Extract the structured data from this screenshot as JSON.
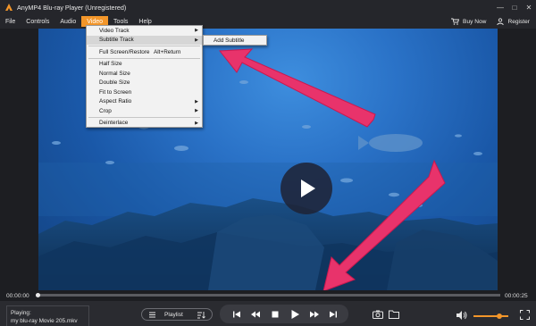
{
  "window": {
    "title": "AnyMP4 Blu-ray Player (Unregistered)",
    "controls": [
      "—",
      "□",
      "✕"
    ]
  },
  "menubar": {
    "items": [
      "File",
      "Controls",
      "Audio",
      "Video",
      "Tools",
      "Help"
    ],
    "active": "Video",
    "buy_now": "Buy Now",
    "register": "Register"
  },
  "video_menu": {
    "items": [
      {
        "label": "Video Track",
        "has_submenu": true
      },
      {
        "label": "Subtitle Track",
        "has_submenu": true,
        "highlighted": true
      },
      {
        "label": "Full Screen/Restore",
        "shortcut": "Alt+Return"
      },
      {
        "label": "Half Size"
      },
      {
        "label": "Normal Size"
      },
      {
        "label": "Double Size"
      },
      {
        "label": "Fit to Screen"
      },
      {
        "label": "Aspect Ratio",
        "has_submenu": true
      },
      {
        "label": "Crop",
        "has_submenu": true
      },
      {
        "label": "Deinterlace",
        "has_submenu": true
      }
    ],
    "submenu": {
      "items": [
        "Add Subtitle"
      ]
    }
  },
  "playback": {
    "current_time": "00:00:00",
    "total_time": "00:00:25",
    "progress": 0.0
  },
  "now_playing": {
    "label": "Playing:",
    "file": "my blu-ray Movie 205.mkv"
  },
  "playlist": {
    "label": "Playlist"
  },
  "volume": {
    "level": 0.7
  },
  "colors": {
    "accent": "#f3962a",
    "annotation": "#e8336b",
    "background": "#1d1e22"
  },
  "icons": [
    "app-logo",
    "cart-icon",
    "user-icon",
    "play-icon",
    "skip-back-icon",
    "rewind-icon",
    "stop-icon",
    "forward-icon",
    "skip-forward-icon",
    "camera-icon",
    "folder-icon",
    "volume-icon",
    "fullscreen-icon",
    "playlist-icon",
    "sort-icon"
  ]
}
